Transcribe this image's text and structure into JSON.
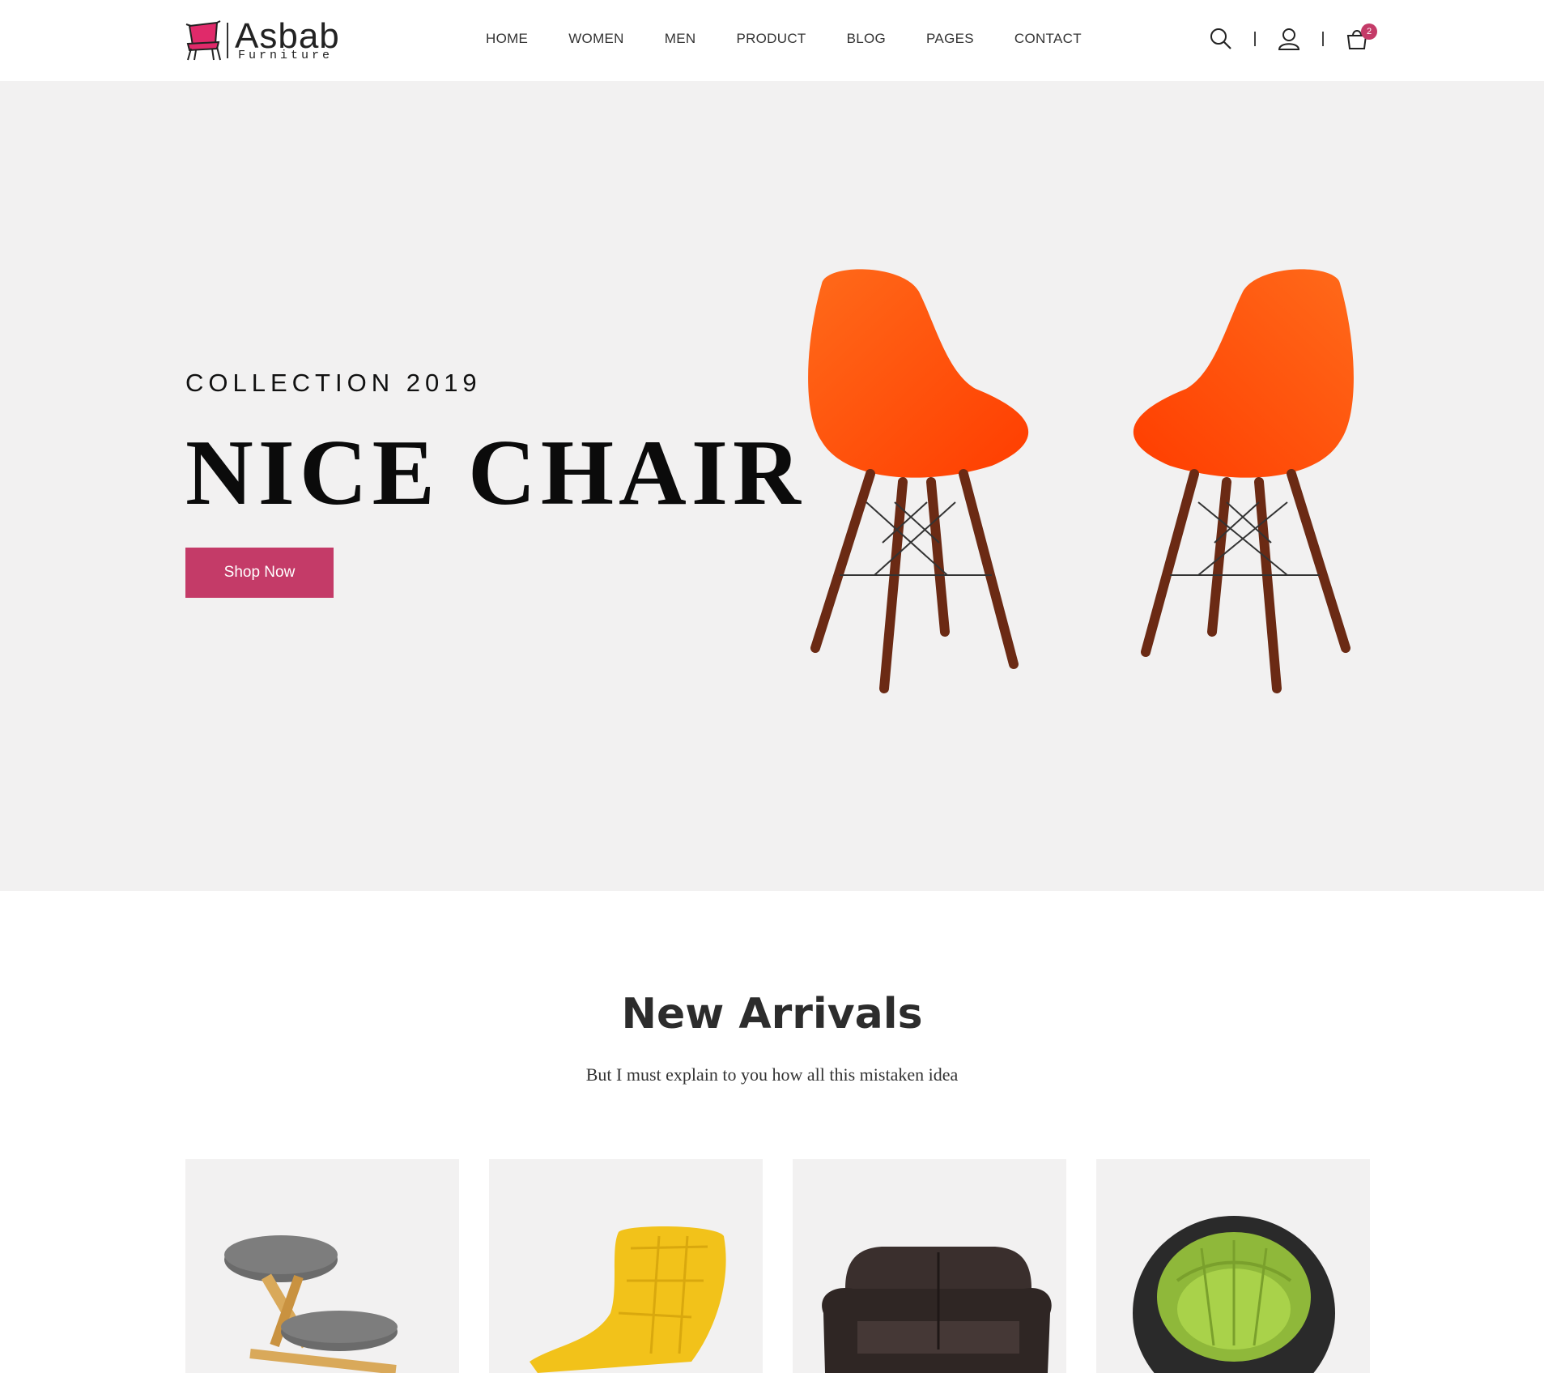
{
  "brand": {
    "name": "Asbab",
    "tagline": "Furniture",
    "accent_color": "#c43b68"
  },
  "nav": {
    "items": [
      {
        "label": "HOME"
      },
      {
        "label": "WOMEN"
      },
      {
        "label": "MEN"
      },
      {
        "label": "PRODUCT"
      },
      {
        "label": "BLOG"
      },
      {
        "label": "PAGES"
      },
      {
        "label": "CONTACT"
      }
    ]
  },
  "header_icons": {
    "search": "search-icon",
    "account": "user-icon",
    "cart": "cart-icon",
    "cart_count": "2"
  },
  "hero": {
    "subtitle": "COLLECTION 2019",
    "title": "NICE CHAIR",
    "button_label": "Shop Now",
    "chair_color": "#ff4a0a"
  },
  "arrivals": {
    "title": "New Arrivals",
    "subtitle": "But I must explain to you how all this mistaken idea",
    "products": [
      {
        "icon": "kneeling-chair-image"
      },
      {
        "icon": "yellow-lounge-chair-image"
      },
      {
        "icon": "leather-loveseat-image"
      },
      {
        "icon": "inflatable-chair-image"
      }
    ]
  }
}
